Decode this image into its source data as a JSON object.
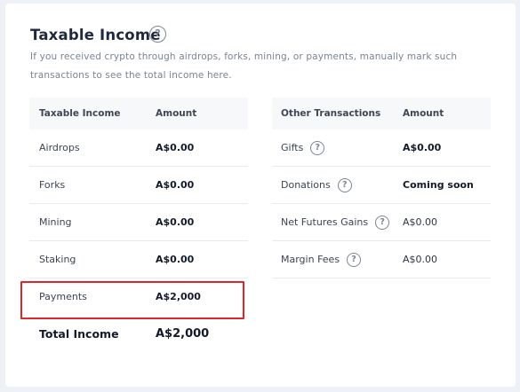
{
  "section": {
    "title": "Taxable Income",
    "description": "If you received crypto through airdrops, forks, mining, or payments, manually mark such transactions to see the total income here.",
    "help_icon": "question-circle-icon"
  },
  "taxable_table": {
    "headers": [
      "Taxable Income",
      "Amount"
    ],
    "rows": [
      {
        "label": "Airdrops",
        "amount": "A$0.00"
      },
      {
        "label": "Forks",
        "amount": "A$0.00"
      },
      {
        "label": "Mining",
        "amount": "A$0.00"
      },
      {
        "label": "Staking",
        "amount": "A$0.00"
      },
      {
        "label": "Payments",
        "amount": "A$2,000"
      }
    ],
    "total": {
      "label": "Total Income",
      "amount": "A$2,000"
    }
  },
  "other_table": {
    "headers": [
      "Other Transactions",
      "Amount"
    ],
    "rows": [
      {
        "label": "Gifts",
        "amount": "A$0.00",
        "help": true
      },
      {
        "label": "Donations",
        "amount": "Coming soon",
        "help": true
      },
      {
        "label": "Net Futures Gains",
        "amount": "A$0.00",
        "help": true
      },
      {
        "label": "Margin Fees",
        "amount": "A$0.00",
        "help": true
      }
    ]
  },
  "highlight_color": "#e1252b"
}
